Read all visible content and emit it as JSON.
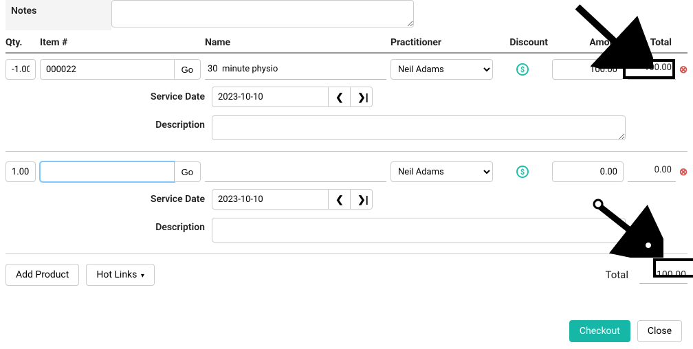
{
  "labels": {
    "notes": "Notes",
    "qty": "Qty.",
    "item_no": "Item #",
    "name": "Name",
    "practitioner": "Practitioner",
    "discount": "Discount",
    "amount": "Amount",
    "total": "Total",
    "service_date": "Service Date",
    "description": "Description",
    "go": "Go",
    "add_product": "Add Product",
    "hot_links": "Hot Links",
    "checkout": "Checkout",
    "close": "Close",
    "total_footer": "Total",
    "prev": "❮",
    "next_end": "❯|"
  },
  "icons": {
    "discount_glyph": "$",
    "delete_glyph": "⊗",
    "caret": "▾"
  },
  "notes_value": "",
  "lines": [
    {
      "qty": "-1.00",
      "item_no": "000022",
      "name": "30  minute physio",
      "practitioner": "Neil Adams",
      "amount": "100.00",
      "total": "-100.00",
      "service_date": "2023-10-10",
      "description": ""
    },
    {
      "qty": "1.00",
      "item_no": "",
      "name": "",
      "practitioner": "Neil Adams",
      "amount": "0.00",
      "total": "0.00",
      "service_date": "2023-10-10",
      "description": ""
    }
  ],
  "grand_total": "-100.00"
}
